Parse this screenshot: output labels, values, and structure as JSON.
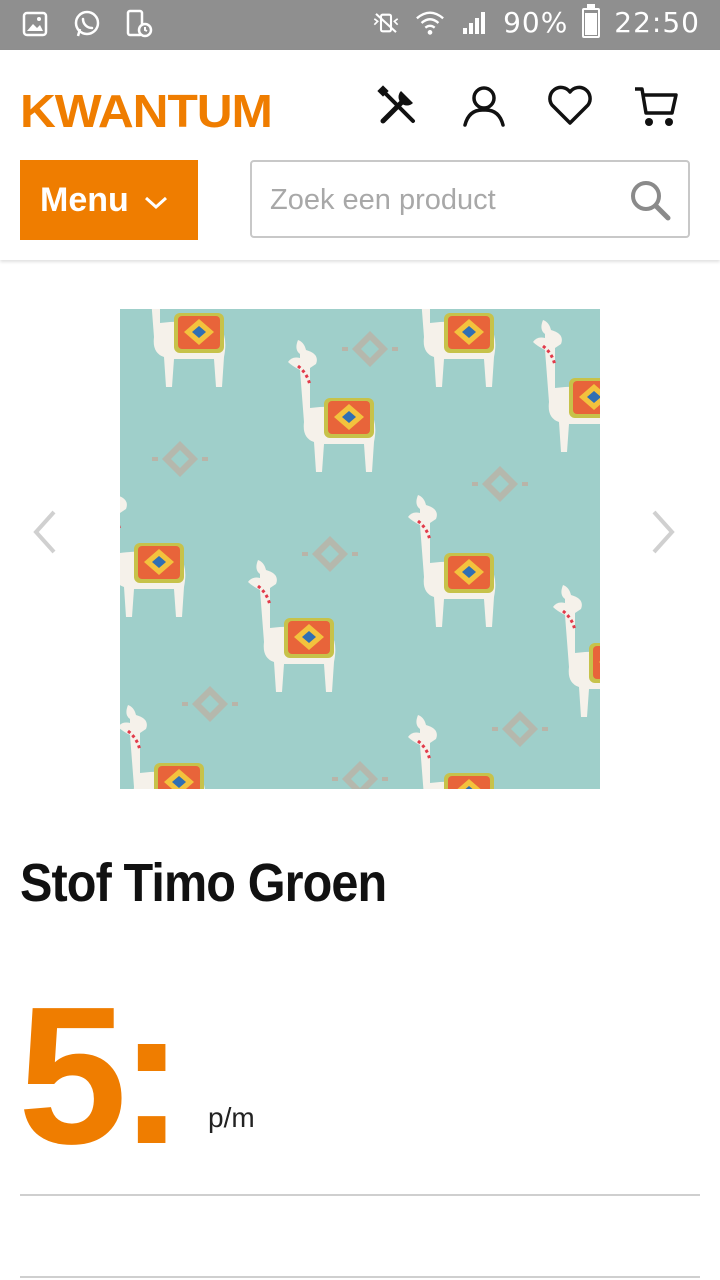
{
  "status_bar": {
    "battery_text": "90%",
    "battery_level": 0.9,
    "time": "22:50",
    "left_icons": [
      "gallery-icon",
      "whatsapp-icon",
      "screen-timer-icon"
    ],
    "right_icons": [
      "vibrate-mute-icon",
      "wifi-icon",
      "signal-icon",
      "battery-icon"
    ]
  },
  "header": {
    "logo": "KWANTUM",
    "icons": [
      "tools-icon",
      "account-icon",
      "wishlist-heart-icon",
      "cart-icon"
    ],
    "menu_label": "Menu",
    "search_placeholder": "Zoek een product",
    "search_value": ""
  },
  "product": {
    "title": "Stof Timo Groen",
    "price": "5:",
    "unit": "p/m",
    "image_icon": "llama-fabric-pattern-image"
  },
  "colors": {
    "brand_orange": "#ef7d00",
    "status_bar": "#8f8f8f",
    "fabric_background": "#9fcfca"
  }
}
